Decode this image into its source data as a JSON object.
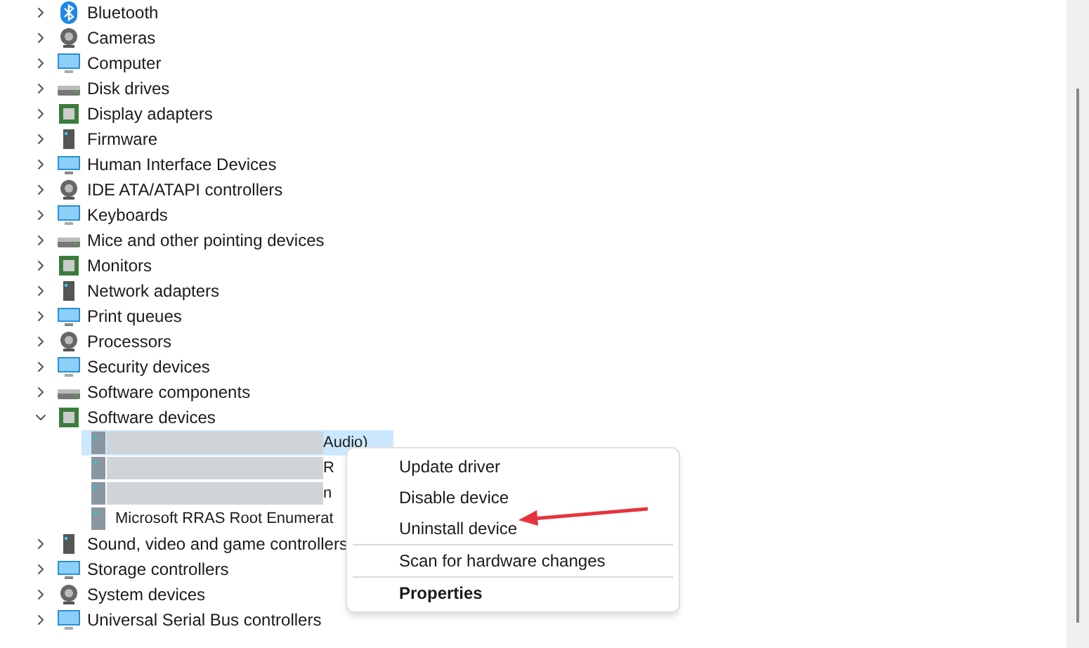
{
  "tree": [
    {
      "label": "Bluetooth",
      "expanded": false
    },
    {
      "label": "Cameras",
      "expanded": false
    },
    {
      "label": "Computer",
      "expanded": false
    },
    {
      "label": "Disk drives",
      "expanded": false
    },
    {
      "label": "Display adapters",
      "expanded": false
    },
    {
      "label": "Firmware",
      "expanded": false
    },
    {
      "label": "Human Interface Devices",
      "expanded": false
    },
    {
      "label": "IDE ATA/ATAPI controllers",
      "expanded": false
    },
    {
      "label": "Keyboards",
      "expanded": false
    },
    {
      "label": "Mice and other pointing devices",
      "expanded": false
    },
    {
      "label": "Monitors",
      "expanded": false
    },
    {
      "label": "Network adapters",
      "expanded": false
    },
    {
      "label": "Print queues",
      "expanded": false
    },
    {
      "label": "Processors",
      "expanded": false
    },
    {
      "label": "Security devices",
      "expanded": false
    },
    {
      "label": "Software components",
      "expanded": false
    },
    {
      "label": "Software devices",
      "expanded": true,
      "children": [
        {
          "label": "Audio)",
          "selected": true,
          "redacted": true
        },
        {
          "label": "R",
          "selected": false,
          "redacted": true
        },
        {
          "label": "n",
          "selected": false,
          "redacted": true
        },
        {
          "label": "Microsoft RRAS Root Enumerat",
          "selected": false,
          "redacted": false
        }
      ]
    },
    {
      "label": "Sound, video and game controllers",
      "expanded": false
    },
    {
      "label": "Storage controllers",
      "expanded": false
    },
    {
      "label": "System devices",
      "expanded": false
    },
    {
      "label": "Universal Serial Bus controllers",
      "expanded": false
    }
  ],
  "context_menu": {
    "groups": [
      [
        {
          "label": "Update driver",
          "bold": false
        },
        {
          "label": "Disable device",
          "bold": false
        },
        {
          "label": "Uninstall device",
          "bold": false
        }
      ],
      [
        {
          "label": "Scan for hardware changes",
          "bold": false
        }
      ],
      [
        {
          "label": "Properties",
          "bold": true
        }
      ]
    ]
  }
}
